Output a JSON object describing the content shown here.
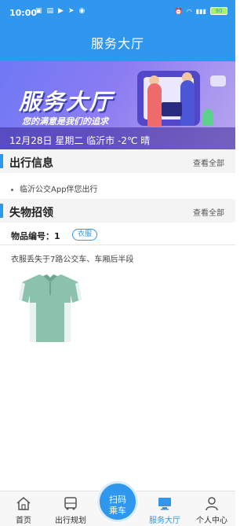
{
  "status_bar": {
    "time": "10:00",
    "left_icons": [
      "notification-icon",
      "image-icon",
      "play-icon",
      "arrow-icon",
      "location-icon"
    ],
    "right_icons": [
      "alarm-icon",
      "location-icon",
      "wifi-icon",
      "signal-icon",
      "battery-icon"
    ],
    "battery": "90"
  },
  "header": {
    "title": "服务大厅"
  },
  "banner": {
    "headline": "服务大厅",
    "slogan": "您的满意是我们的追求",
    "info": "12月28日 星期二 临沂市 -2℃ 晴"
  },
  "travel_info": {
    "title": "出行信息",
    "more": "查看全部",
    "items": [
      "临沂公交App伴您出行"
    ]
  },
  "lost_found": {
    "title": "失物招领",
    "more": "查看全部",
    "item_label": "物品编号：1",
    "tag": "衣服",
    "description": "衣服丢失于7路公交车、车厢后半段"
  },
  "bottom_nav": {
    "items": [
      {
        "label": "首页",
        "icon": "home-icon"
      },
      {
        "label": "出行规划",
        "icon": "bus-icon"
      },
      {
        "label": "服务大厅",
        "icon": "monitor-icon"
      },
      {
        "label": "个人中心",
        "icon": "person-icon"
      }
    ],
    "scan_button": {
      "line1": "扫码",
      "line2": "乘车"
    },
    "active_color": "#2f97ee"
  },
  "colors": {
    "primary": "#2f97ee",
    "section_bg": "#f4f4f4"
  }
}
